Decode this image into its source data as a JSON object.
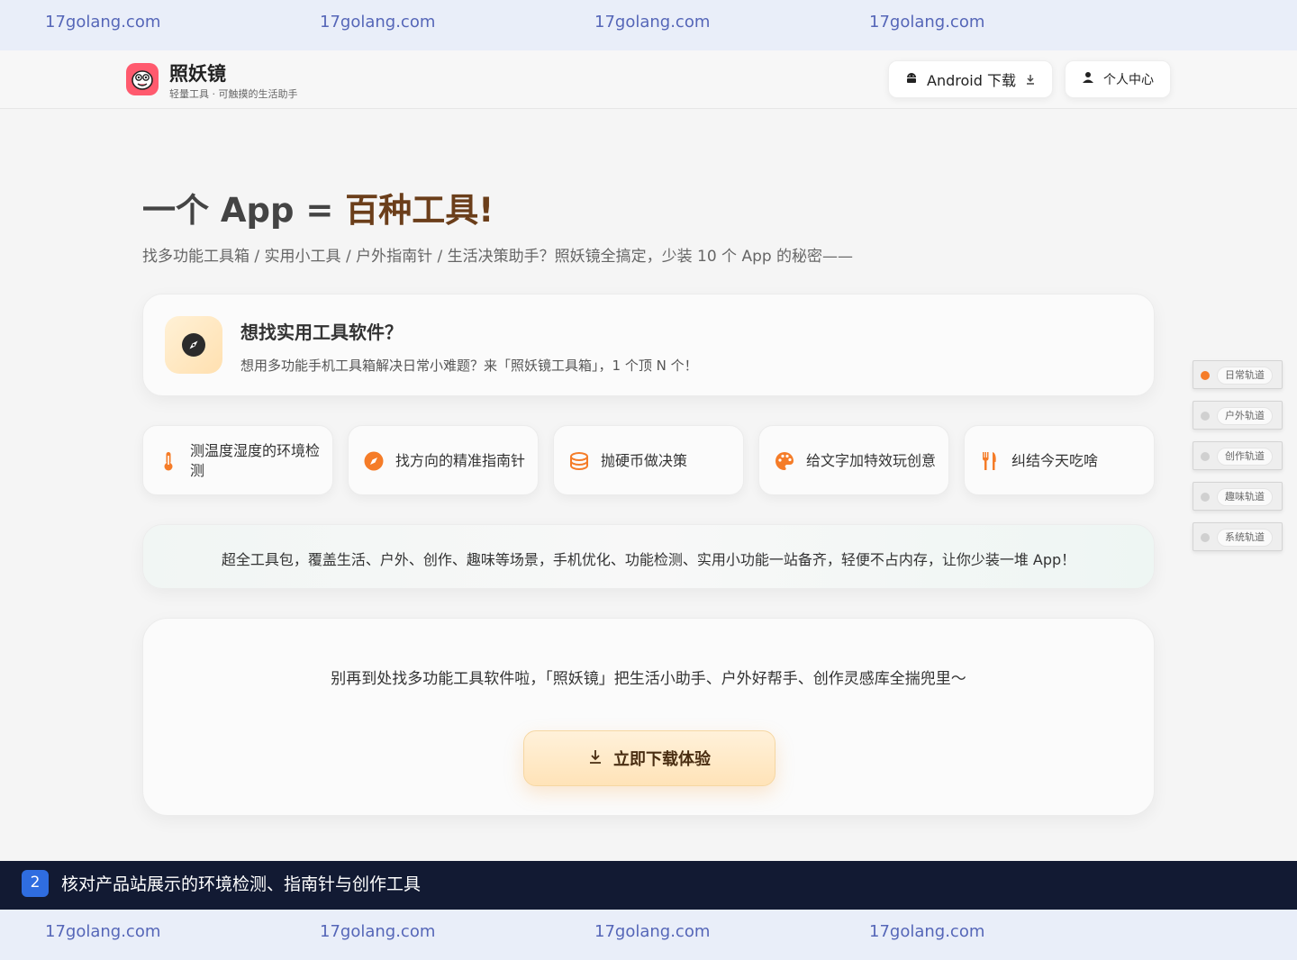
{
  "watermark": {
    "text": "17golang.com",
    "top": [
      "17golang.com",
      "17golang.com",
      "17golang.com",
      "17golang.com"
    ],
    "bottom": [
      "17golang.com",
      "17golang.com",
      "17golang.com",
      "17golang.com"
    ]
  },
  "header": {
    "logo_icon": "cartoon-face-icon",
    "app_name": "照妖镜",
    "tagline": "轻量工具 · 可触摸的生活助手",
    "android_button": {
      "label": "Android 下载",
      "icon": "android-icon",
      "trailing_icon": "download-icon"
    },
    "user_button": {
      "label": "个人中心",
      "icon": "user-icon"
    }
  },
  "hero": {
    "title_prefix": "一个 App = ",
    "title_accent": "百种工具!",
    "subtitle": "找多功能工具箱 / 实用小工具 / 户外指南针 / 生活决策助手？照妖镜全搞定，少装 10 个 App 的秘密——"
  },
  "intro_card": {
    "icon": "compass-icon",
    "title": "想找实用工具软件？",
    "description": "想用多功能手机工具箱解决日常小难题？来「照妖镜工具箱」，1 个顶 N 个！"
  },
  "features": [
    {
      "label": "测温度湿度的环境检测",
      "icon": "thermometer-icon",
      "color": "#f57c28"
    },
    {
      "label": "找方向的精准指南针",
      "icon": "compass-icon",
      "color": "#f57c28"
    },
    {
      "label": "抛硬币做决策",
      "icon": "coin-icon",
      "color": "#f57c28"
    },
    {
      "label": "给文字加特效玩创意",
      "icon": "palette-icon",
      "color": "#f57c28"
    },
    {
      "label": "纠结今天吃啥",
      "icon": "utensils-icon",
      "color": "#f57c28"
    }
  ],
  "banner": {
    "text": "超全工具包，覆盖生活、户外、创作、趣味等场景，手机优化、功能检测、实用小功能一站备齐，轻便不占内存，让你少装一堆 App！"
  },
  "cta": {
    "text": "别再到处找多功能工具软件啦，「照妖镜」把生活小助手、户外好帮手、创作灵感库全揣兜里～",
    "button_label": "立即下载体验",
    "button_icon": "download-icon"
  },
  "side_rail": [
    {
      "label": "日常轨道",
      "active": true
    },
    {
      "label": "户外轨道",
      "active": false
    },
    {
      "label": "创作轨道",
      "active": false
    },
    {
      "label": "趣味轨道",
      "active": false
    },
    {
      "label": "系统轨道",
      "active": false
    }
  ],
  "caption": {
    "number": "2",
    "text": "核对产品站展示的环境检测、指南针与创作工具"
  },
  "colors": {
    "accent": "#f57c28",
    "brand_brown": "#6b3e1a",
    "caption_bg": "#121a33",
    "caption_badge": "#2f6de0",
    "watermark_bg": "#e9eef9"
  }
}
